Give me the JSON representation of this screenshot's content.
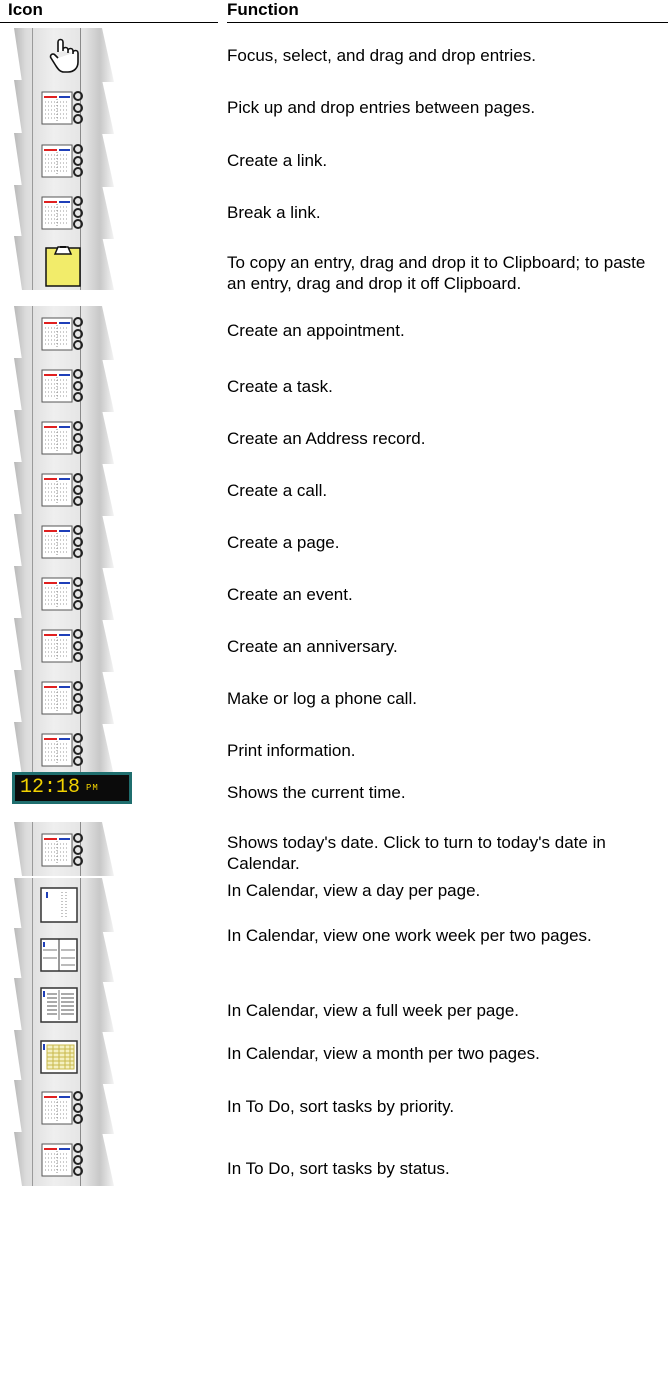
{
  "table": {
    "headers": {
      "icon": "Icon",
      "function": "Function"
    },
    "rows": [
      {
        "icon": "hand-pointer-icon",
        "description": "Focus, select, and drag and drop entries."
      },
      {
        "icon": "organizer-book-icon",
        "description": "Pick up and drop entries between pages."
      },
      {
        "icon": "organizer-book-icon",
        "description": "Create a link."
      },
      {
        "icon": "organizer-book-icon",
        "description": "Break a link."
      },
      {
        "icon": "clipboard-icon",
        "description": "To copy an entry, drag and drop it to Clipboard; to paste an entry, drag and drop it off Clipboard."
      },
      {
        "icon": "organizer-book-icon",
        "description": "Create an appointment."
      },
      {
        "icon": "organizer-book-icon",
        "description": "Create a task."
      },
      {
        "icon": "organizer-book-icon",
        "description": "Create an Address record."
      },
      {
        "icon": "organizer-book-icon",
        "description": "Create a call."
      },
      {
        "icon": "organizer-book-icon",
        "description": "Create a page."
      },
      {
        "icon": "organizer-book-icon",
        "description": "Create an event."
      },
      {
        "icon": "organizer-book-icon",
        "description": "Create an anniversary."
      },
      {
        "icon": "organizer-book-icon",
        "description": "Make or log a phone call."
      },
      {
        "icon": "organizer-book-icon",
        "description": "Print information."
      },
      {
        "icon": "digital-clock-icon",
        "description": "Shows the current time.",
        "clock": {
          "time": "12:18",
          "ampm": "PM"
        }
      },
      {
        "icon": "organizer-book-icon",
        "description": "Shows today's date. Click to turn to today's date in Calendar."
      },
      {
        "icon": "day-view-icon",
        "description": "In Calendar, view a day per page."
      },
      {
        "icon": "work-week-view-icon",
        "description": "In Calendar, view one work week per two pages."
      },
      {
        "icon": "full-week-view-icon",
        "description": "In Calendar, view a full week per page."
      },
      {
        "icon": "month-view-icon",
        "description": "In Calendar, view a month per two pages."
      },
      {
        "icon": "organizer-book-icon",
        "description": "In To Do, sort tasks by priority."
      },
      {
        "icon": "organizer-book-icon",
        "description": "In To Do, sort tasks by status."
      }
    ]
  },
  "colors": {
    "clock_digits": "#f2d200",
    "clock_border": "#1f6e6e",
    "clipboard_fill": "#f2ec6a",
    "month_grid": "#c8b84a",
    "book_red": "#e02020",
    "book_blue": "#1f3fb8"
  }
}
